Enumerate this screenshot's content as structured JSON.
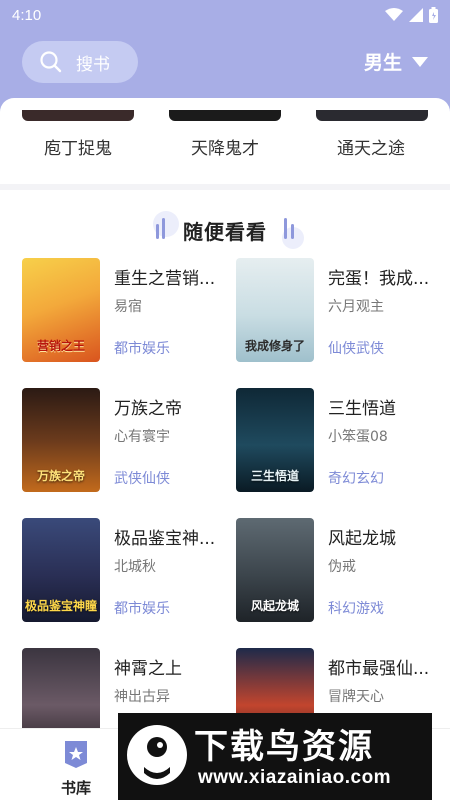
{
  "status_bar": {
    "time": "4:10",
    "icons": [
      "wifi-icon",
      "signal-icon",
      "battery-icon"
    ]
  },
  "header": {
    "search_label": "搜书",
    "gender_label": "男生"
  },
  "previous_row": [
    "庖丁捉鬼",
    "天降鬼才",
    "通天之途"
  ],
  "section": {
    "title": "随便看看"
  },
  "books": [
    {
      "title": "重生之营销...",
      "author": "易宿",
      "genre": "都市娱乐",
      "cover_text": "营销之王"
    },
    {
      "title": "完蛋！我成...",
      "author": "六月观主",
      "genre": "仙侠武侠",
      "cover_text": "我成修身了"
    },
    {
      "title": "万族之帝",
      "author": "心有寰宇",
      "genre": "武侠仙侠",
      "cover_text": "万族之帝"
    },
    {
      "title": "三生悟道",
      "author": "小笨蛋08",
      "genre": "奇幻玄幻",
      "cover_text": "三生悟道"
    },
    {
      "title": "极品鉴宝神...",
      "author": "北城秋",
      "genre": "都市娱乐",
      "cover_text": "极品鉴宝神瞳"
    },
    {
      "title": "风起龙城",
      "author": "伪戒",
      "genre": "科幻游戏",
      "cover_text": "风起龙城"
    },
    {
      "title": "神霄之上",
      "author": "神出古异",
      "genre": "",
      "cover_text": ""
    },
    {
      "title": "都市最强仙...",
      "author": "冒牌天心",
      "genre": "",
      "cover_text": ""
    }
  ],
  "bottom_nav": {
    "shelf_label": "书库"
  },
  "watermark": {
    "title": "下载鸟资源",
    "url": "www.xiazainiao.com"
  },
  "colors": {
    "accent": "#a8aee6",
    "genre": "#7d8ad6"
  }
}
